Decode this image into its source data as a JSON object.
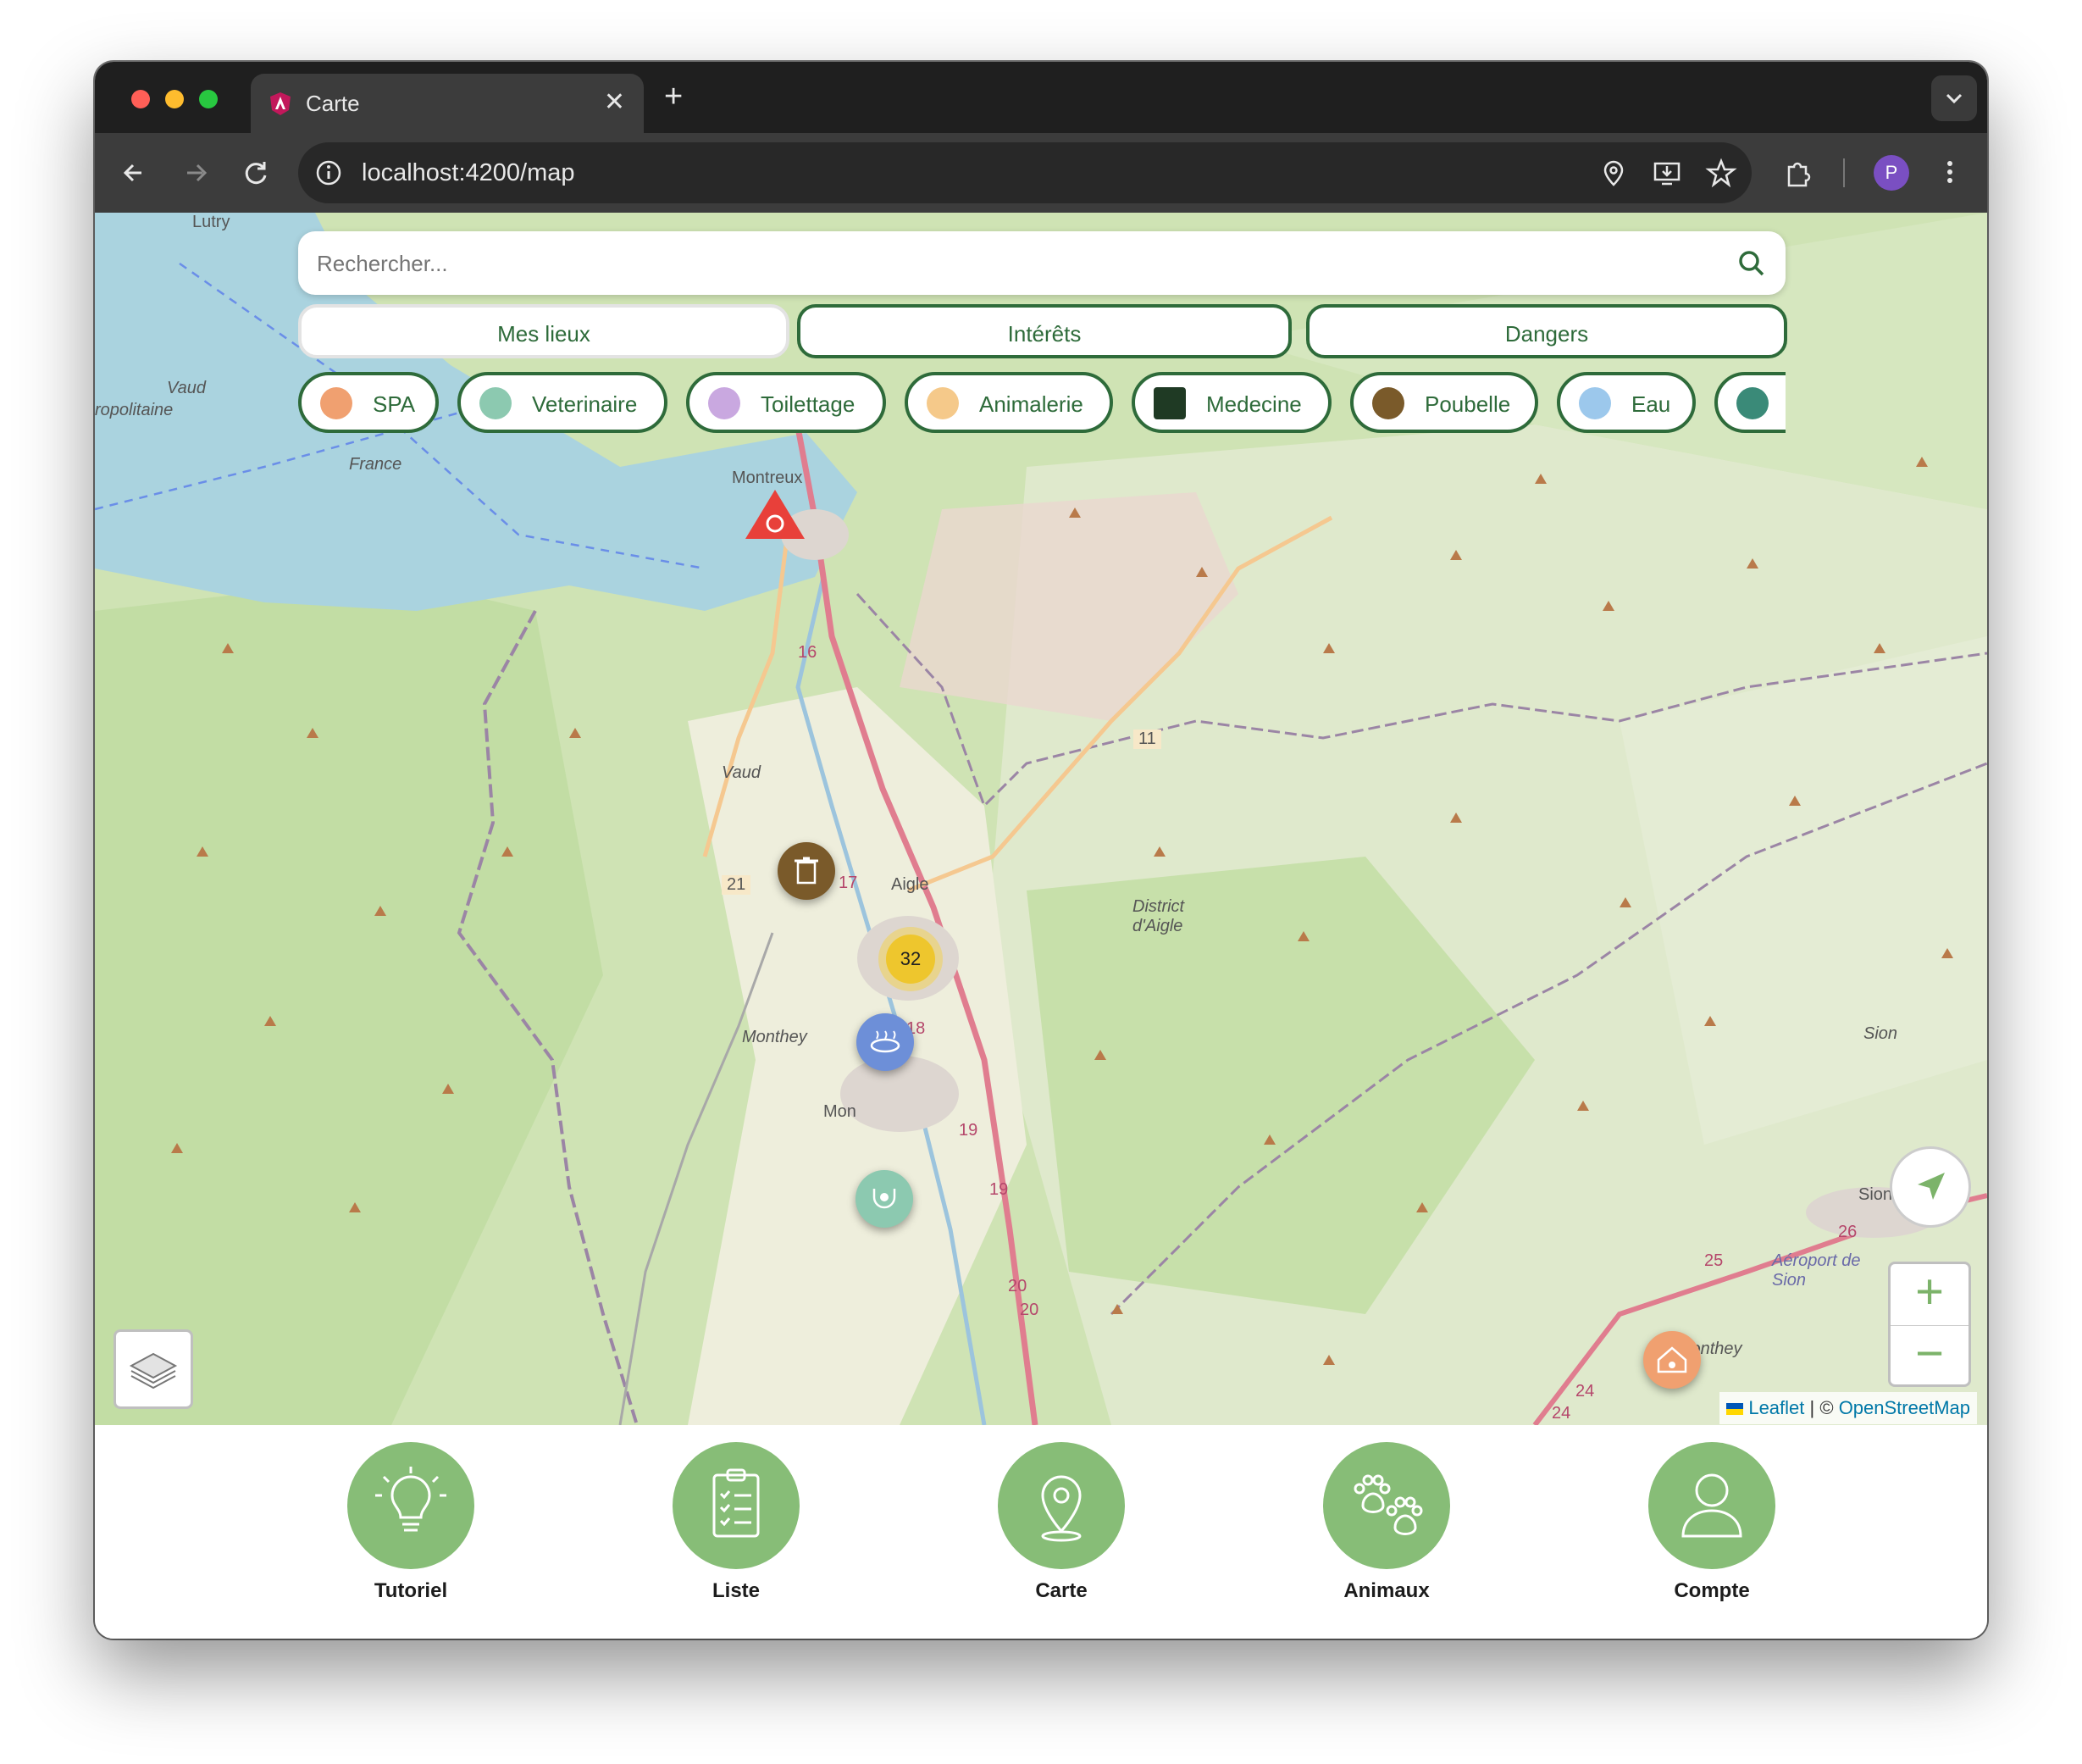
{
  "browser": {
    "tab_title": "Carte",
    "url": "localhost:4200/map",
    "profile_initial": "P"
  },
  "search": {
    "placeholder": "Rechercher..."
  },
  "tabs": [
    {
      "label": "Mes lieux",
      "active": true
    },
    {
      "label": "Intérêts",
      "active": false
    },
    {
      "label": "Dangers",
      "active": false
    }
  ],
  "categories": [
    {
      "label": "SPA",
      "icon": "house-paw-icon",
      "color": "#f0a070"
    },
    {
      "label": "Veterinaire",
      "icon": "stethoscope-paw-icon",
      "color": "#8cc9b0"
    },
    {
      "label": "Toilettage",
      "icon": "grooming-icon",
      "color": "#c9a8e0"
    },
    {
      "label": "Animalerie",
      "icon": "pet-shop-icon",
      "color": "#f5c98a"
    },
    {
      "label": "Medecine",
      "icon": "hospital-icon",
      "color": "#1f3a24"
    },
    {
      "label": "Poubelle",
      "icon": "trash-icon",
      "color": "#7a5a2a"
    },
    {
      "label": "Eau",
      "icon": "water-drop-icon",
      "color": "#9cc8ec"
    },
    {
      "label": "",
      "icon": "dog-icon",
      "color": "#3a8a78"
    }
  ],
  "map": {
    "place_labels": [
      "Lutry",
      "Vaud",
      "ropolitaine",
      "France",
      "Montreux",
      "Vaud",
      "Aigle",
      "District d'Aigle",
      "Monthey",
      "Mon",
      "Sion",
      "Sion",
      "Aéroport de Sion",
      "Conthey"
    ],
    "road_numbers": [
      "16",
      "11",
      "21",
      "17",
      "18",
      "19",
      "19",
      "20",
      "20",
      "25",
      "26",
      "24",
      "24"
    ],
    "cluster_count": "32",
    "attribution": {
      "leaflet": "Leaflet",
      "separator": "| ©",
      "osm": "OpenStreetMap"
    }
  },
  "bottom_nav": [
    {
      "label": "Tutoriel",
      "icon": "lightbulb-icon"
    },
    {
      "label": "Liste",
      "icon": "clipboard-list-icon"
    },
    {
      "label": "Carte",
      "icon": "map-pin-icon"
    },
    {
      "label": "Animaux",
      "icon": "paws-icon"
    },
    {
      "label": "Compte",
      "icon": "user-icon"
    }
  ]
}
